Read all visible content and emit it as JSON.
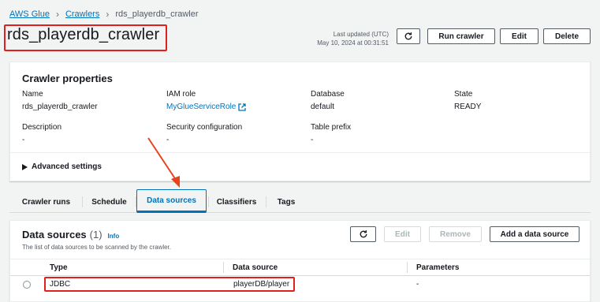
{
  "breadcrumb": {
    "items": [
      "AWS Glue",
      "Crawlers",
      "rds_playerdb_crawler"
    ]
  },
  "header": {
    "title": "rds_playerdb_crawler",
    "last_updated_label": "Last updated (UTC)",
    "last_updated_value": "May 10, 2024 at 00:31:51",
    "buttons": {
      "run_crawler": "Run crawler",
      "edit": "Edit",
      "delete": "Delete"
    }
  },
  "properties": {
    "title": "Crawler properties",
    "name_label": "Name",
    "name_value": "rds_playerdb_crawler",
    "iam_label": "IAM role",
    "iam_value": "MyGlueServiceRole",
    "database_label": "Database",
    "database_value": "default",
    "state_label": "State",
    "state_value": "READY",
    "description_label": "Description",
    "description_value": "-",
    "security_label": "Security configuration",
    "security_value": "-",
    "prefix_label": "Table prefix",
    "prefix_value": "-",
    "advanced": "Advanced settings"
  },
  "tabs": [
    "Crawler runs",
    "Schedule",
    "Data sources",
    "Classifiers",
    "Tags"
  ],
  "active_tab": "Data sources",
  "data_sources": {
    "title": "Data sources",
    "count": "(1)",
    "info": "Info",
    "description": "The list of data sources to be scanned by the crawler.",
    "buttons": {
      "edit": "Edit",
      "remove": "Remove",
      "add": "Add a data source"
    },
    "columns": [
      "Type",
      "Data source",
      "Parameters"
    ],
    "rows": [
      {
        "type": "JDBC",
        "source": "playerDB/player",
        "parameters": "-"
      }
    ]
  },
  "colors": {
    "link": "#0073bb",
    "highlight_red": "#e0201d",
    "arrow": "#e8431e"
  }
}
